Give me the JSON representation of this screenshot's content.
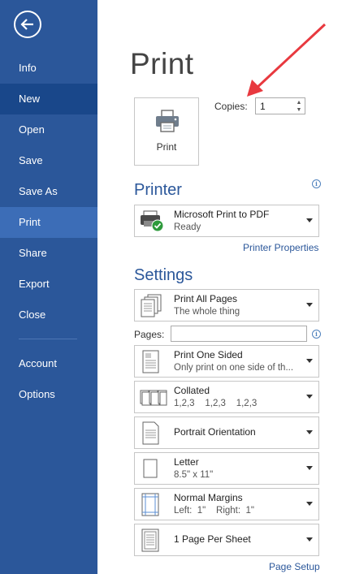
{
  "sidebar": {
    "items": [
      {
        "label": "Info"
      },
      {
        "label": "New"
      },
      {
        "label": "Open"
      },
      {
        "label": "Save"
      },
      {
        "label": "Save As"
      },
      {
        "label": "Print"
      },
      {
        "label": "Share"
      },
      {
        "label": "Export"
      },
      {
        "label": "Close"
      },
      {
        "label": "Account"
      },
      {
        "label": "Options"
      }
    ],
    "active": "Print",
    "hover": "New"
  },
  "main": {
    "title": "Print",
    "print_button_label": "Print",
    "copies_label": "Copies:",
    "copies_value": "1"
  },
  "printer": {
    "section_title": "Printer",
    "name": "Microsoft Print to PDF",
    "status": "Ready",
    "properties_link": "Printer Properties"
  },
  "settings": {
    "section_title": "Settings",
    "pages_label": "Pages:",
    "pages_value": "",
    "range": {
      "line1": "Print All Pages",
      "line2": "The whole thing"
    },
    "sides": {
      "line1": "Print One Sided",
      "line2": "Only print on one side of th..."
    },
    "collate": {
      "line1": "Collated",
      "line2": "1,2,3    1,2,3    1,2,3"
    },
    "orientation": {
      "line1": "Portrait Orientation"
    },
    "paper": {
      "line1": "Letter",
      "line2": "8.5\" x 11\""
    },
    "margins": {
      "line1": "Normal Margins",
      "line2": "Left:  1\"    Right:  1\""
    },
    "per_sheet": {
      "line1": "1 Page Per Sheet"
    },
    "page_setup_link": "Page Setup"
  },
  "colors": {
    "sidebar_bg": "#2b579a",
    "sidebar_active": "#3c6db7",
    "sidebar_hover": "#19478a",
    "accent": "#2b579a",
    "annotation_arrow": "#e8393f"
  },
  "icons": [
    "back-arrow-icon",
    "printer-icon",
    "info-icon",
    "printer-ready-icon",
    "caret-down-icon"
  ]
}
